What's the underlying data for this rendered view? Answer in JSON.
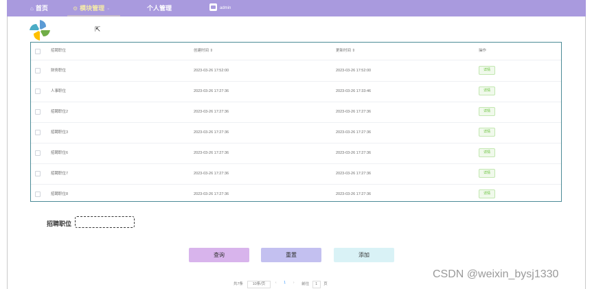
{
  "nav": {
    "home": "首页",
    "module": "模块管理",
    "personal": "个人管理",
    "user": "admin"
  },
  "table": {
    "headers": {
      "name": "招聘职位",
      "created": "创建时间 ⇕",
      "updated": "更新时间 ⇕",
      "operation": "操作"
    },
    "rows": [
      {
        "name": "财务职位",
        "created": "2023-03-26 17:52:00",
        "updated": "2023-03-26 17:52:00",
        "action": "详情"
      },
      {
        "name": "人事职位",
        "created": "2023-03-26 17:27:36",
        "updated": "2023-03-26 17:33:46",
        "action": "详情"
      },
      {
        "name": "招聘职位2",
        "created": "2023-03-26 17:27:36",
        "updated": "2023-03-26 17:27:36",
        "action": "详情"
      },
      {
        "name": "招聘职位3",
        "created": "2023-03-26 17:27:36",
        "updated": "2023-03-26 17:27:36",
        "action": "详情"
      },
      {
        "name": "招聘职位6",
        "created": "2023-03-26 17:27:36",
        "updated": "2023-03-26 17:27:36",
        "action": "详情"
      },
      {
        "name": "招聘职位7",
        "created": "2023-03-26 17:27:36",
        "updated": "2023-03-26 17:27:36",
        "action": "详情"
      },
      {
        "name": "招聘职位8",
        "created": "2023-03-26 17:27:36",
        "updated": "2023-03-26 17:27:36",
        "action": "详情"
      }
    ]
  },
  "search": {
    "label": "招聘职位",
    "value": ""
  },
  "buttons": {
    "query": "查询",
    "reset": "重置",
    "add": "添加"
  },
  "pagination": {
    "total": "共7条",
    "page_size": "10条/页",
    "prev": "‹",
    "current": "1",
    "next": "›",
    "goto_label": "前往",
    "goto_value": "1",
    "page_unit": "页"
  },
  "watermark": "CSDN @weixin_bysj1330",
  "colors": {
    "topbar": "#a99ade",
    "table_border": "#4a8a96",
    "query_button": "#d8b4ec",
    "reset_button": "#c3c0f0",
    "add_button": "#d9f2f6",
    "detail_button_text": "#67c23a"
  },
  "icons": {
    "home": "home-icon",
    "module": "gear-icon",
    "logo": "pinwheel-logo",
    "avatar": "avatar-icon"
  }
}
